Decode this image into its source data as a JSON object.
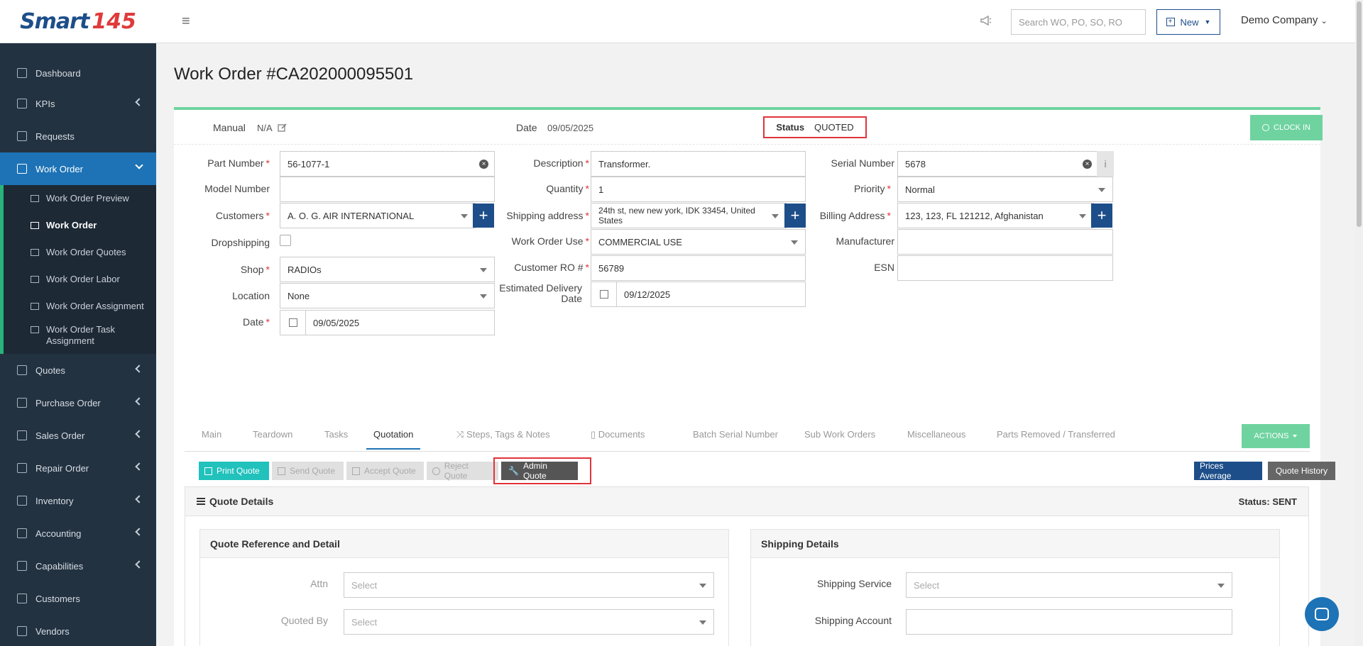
{
  "brand": {
    "logo_text": "Smart",
    "logo_number": "145"
  },
  "sidebar": {
    "items": [
      {
        "label": "Dashboard",
        "icon": "chart-icon"
      },
      {
        "label": "KPIs",
        "icon": "kpi-icon"
      },
      {
        "label": "Requests",
        "icon": "document-icon"
      },
      {
        "label": "Work Order",
        "icon": "work-order-icon"
      },
      {
        "label": "Quotes",
        "icon": "quote-icon"
      },
      {
        "label": "Purchase Order",
        "icon": "cart-icon"
      },
      {
        "label": "Sales Order",
        "icon": "sales-icon"
      },
      {
        "label": "Repair Order",
        "icon": "repair-icon"
      },
      {
        "label": "Inventory",
        "icon": "inventory-icon"
      },
      {
        "label": "Accounting",
        "icon": "accounting-icon"
      },
      {
        "label": "Capabilities",
        "icon": "capabilities-icon"
      },
      {
        "label": "Customers",
        "icon": "customers-icon"
      },
      {
        "label": "Vendors",
        "icon": "vendors-icon"
      }
    ],
    "work_order_sub": [
      "Work Order Preview",
      "Work Order",
      "Work Order Quotes",
      "Work Order Labor",
      "Work Order Assignment",
      "Work Order Task Assignment"
    ]
  },
  "header": {
    "search_placeholder": "Search WO, PO, SO, RO",
    "new_label": "New",
    "company": "Demo Company"
  },
  "page": {
    "title": "Work Order #CA202000095501"
  },
  "summary": {
    "manual_label": "Manual",
    "manual_value": "N/A",
    "date_label": "Date",
    "date_value": "09/05/2025",
    "status_label": "Status",
    "status_value": "QUOTED",
    "clock_in": "CLOCK IN"
  },
  "form": {
    "part_number": {
      "label": "Part Number",
      "value": "56-1077-1"
    },
    "model_number": {
      "label": "Model Number",
      "value": ""
    },
    "customers": {
      "label": "Customers",
      "value": "A. O. G. AIR INTERNATIONAL"
    },
    "dropshipping": {
      "label": "Dropshipping"
    },
    "shop": {
      "label": "Shop",
      "value": "RADIOs"
    },
    "location": {
      "label": "Location",
      "value": "None"
    },
    "date": {
      "label": "Date",
      "value": "09/05/2025"
    },
    "description": {
      "label": "Description",
      "value": "Transformer."
    },
    "quantity": {
      "label": "Quantity",
      "value": "1"
    },
    "shipping_address": {
      "label": "Shipping address",
      "value": "24th st, new new york, IDK 33454, United States"
    },
    "work_order_use": {
      "label": "Work Order Use",
      "value": "COMMERCIAL USE"
    },
    "customer_ro": {
      "label": "Customer RO #",
      "value": "56789"
    },
    "estimated_delivery": {
      "label1": "Estimated Delivery",
      "label2": "Date",
      "value": "09/12/2025"
    },
    "serial_number": {
      "label": "Serial Number",
      "value": "5678"
    },
    "priority": {
      "label": "Priority",
      "value": "Normal"
    },
    "billing_address": {
      "label": "Billing Address",
      "value": "123, 123, FL 121212, Afghanistan"
    },
    "manufacturer": {
      "label": "Manufacturer",
      "value": ""
    },
    "esn": {
      "label": "ESN",
      "value": ""
    }
  },
  "tabs": [
    "Main",
    "Teardown",
    "Tasks",
    "Quotation",
    "Steps, Tags & Notes",
    "Documents",
    "Batch Serial Number",
    "Sub Work Orders",
    "Miscellaneous",
    "Parts Removed / Transferred"
  ],
  "actions_label": "ACTIONS",
  "quote_buttons": {
    "print": "Print Quote",
    "send": "Send Quote",
    "accept": "Accept Quote",
    "reject": "Reject Quote",
    "admin": "Admin Quote",
    "prices_avg": "Prices Average",
    "history": "Quote History"
  },
  "quote_details": {
    "title": "Quote Details",
    "status": "Status: SENT",
    "reference_card": {
      "title": "Quote Reference and Detail",
      "attn_label": "Attn",
      "attn_placeholder": "Select",
      "quoted_by_label": "Quoted By",
      "quoted_by_placeholder": "Select"
    },
    "shipping_card": {
      "title": "Shipping Details",
      "service_label": "Shipping Service",
      "service_placeholder": "Select",
      "account_label": "Shipping Account"
    }
  },
  "colors": {
    "sidebar_bg": "#233241",
    "active_nav": "#1d73b6",
    "accent_green": "#6fd3a0",
    "brand_navy": "#1d4e89",
    "highlight_red": "#e0343b"
  }
}
